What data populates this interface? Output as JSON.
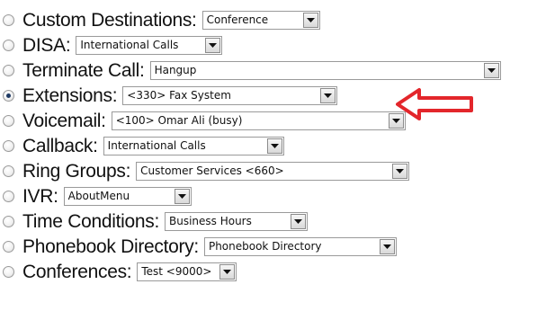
{
  "destinations": [
    {
      "label": "Custom Destinations:",
      "value": "Conference",
      "checked": false,
      "icon": "radio-icon"
    },
    {
      "label": "DISA:",
      "value": "International Calls",
      "checked": false,
      "icon": "radio-icon"
    },
    {
      "label": "Terminate Call:",
      "value": "Hangup",
      "checked": false,
      "icon": "radio-icon"
    },
    {
      "label": "Extensions:",
      "value": "<330> Fax System",
      "checked": true,
      "icon": "radio-icon"
    },
    {
      "label": "Voicemail:",
      "value": "<100> Omar Ali (busy)",
      "checked": false,
      "icon": "radio-icon"
    },
    {
      "label": "Callback:",
      "value": "International Calls",
      "checked": false,
      "icon": "radio-icon"
    },
    {
      "label": "Ring Groups:",
      "value": "Customer Services <660>",
      "checked": false,
      "icon": "radio-icon"
    },
    {
      "label": "IVR:",
      "value": "AboutMenu",
      "checked": false,
      "icon": "radio-icon"
    },
    {
      "label": "Time Conditions:",
      "value": "Business Hours",
      "checked": false,
      "icon": "radio-icon"
    },
    {
      "label": "Phonebook Directory:",
      "value": "Phonebook Directory",
      "checked": false,
      "icon": "radio-icon"
    },
    {
      "label": "Conferences:",
      "value": "Test <9000>",
      "checked": false,
      "icon": "radio-icon"
    }
  ],
  "annotation": {
    "icon": "red-arrow-icon",
    "color": "#e3262b",
    "points_to": "Extensions:"
  },
  "dropdown_icon": "chevron-down-icon"
}
